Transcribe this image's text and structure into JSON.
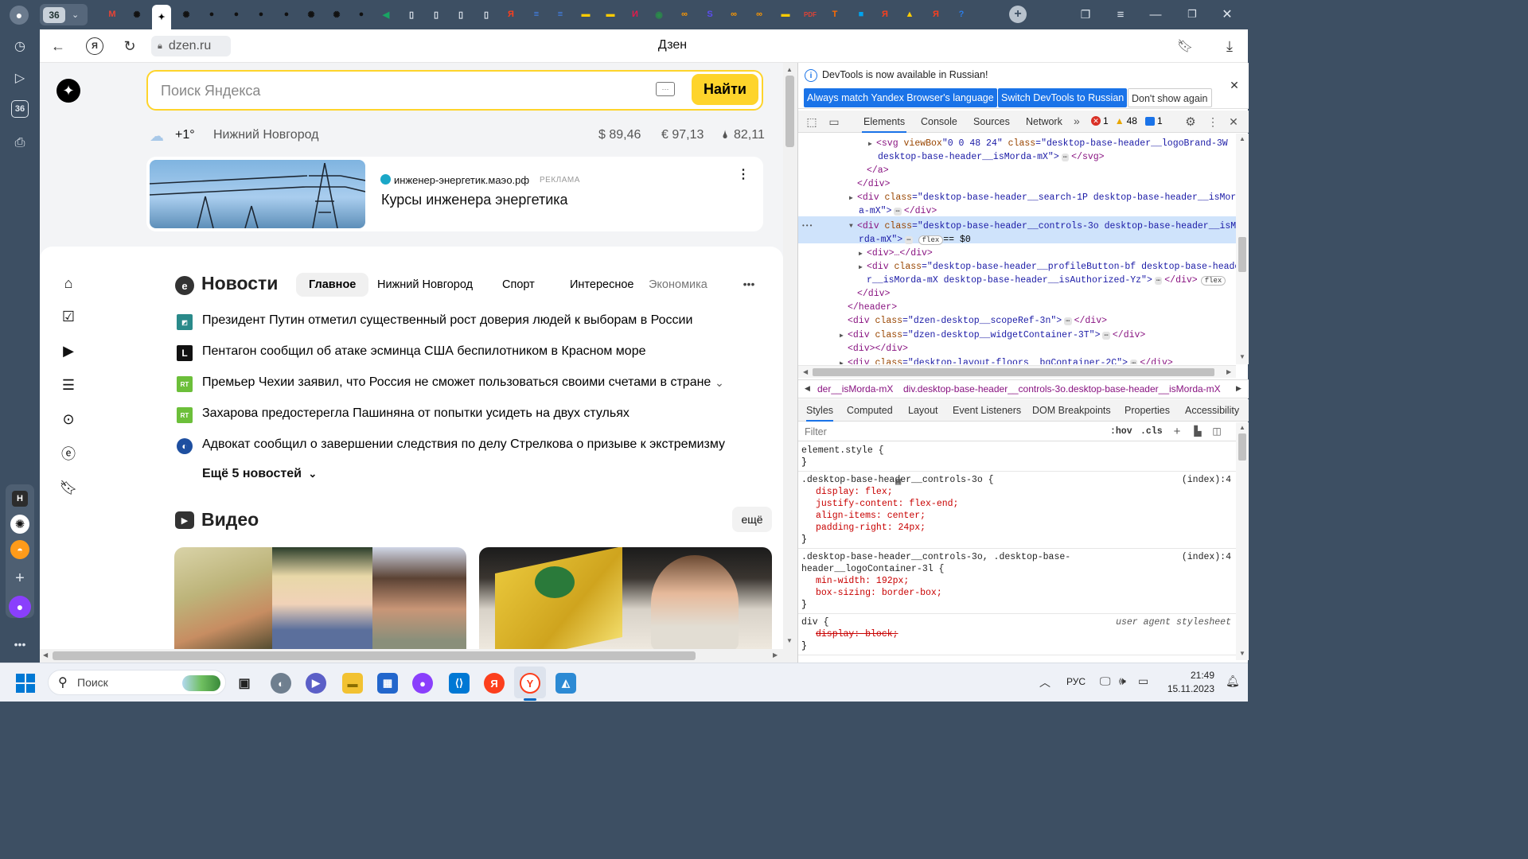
{
  "tabs": {
    "counter": "36",
    "items": [
      {
        "name": "gmail-tab",
        "glyph": "M",
        "color": "#ea4335"
      },
      {
        "name": "chatgpt-tab-1",
        "glyph": "✺",
        "color": "#111"
      },
      {
        "name": "dzen-tab-active",
        "glyph": "✦",
        "color": "#fff"
      },
      {
        "name": "chatgpt-tab-2",
        "glyph": "✺",
        "color": "#111"
      },
      {
        "name": "github-tab-1",
        "glyph": "●",
        "color": "#111"
      },
      {
        "name": "github-tab-2",
        "glyph": "●",
        "color": "#111"
      },
      {
        "name": "github-tab-3",
        "glyph": "●",
        "color": "#111"
      },
      {
        "name": "github-tab-4",
        "glyph": "●",
        "color": "#111"
      },
      {
        "name": "chatgpt-tab-3",
        "glyph": "✺",
        "color": "#111"
      },
      {
        "name": "chatgpt-tab-4",
        "glyph": "✺",
        "color": "#111"
      },
      {
        "name": "github-tab-5",
        "glyph": "●",
        "color": "#111"
      },
      {
        "name": "green-arrow-tab",
        "glyph": "◀",
        "color": "#19a463"
      },
      {
        "name": "doc-tab-1",
        "glyph": "▯",
        "color": "#dfe6ee"
      },
      {
        "name": "doc-tab-2",
        "glyph": "▯",
        "color": "#dfe6ee"
      },
      {
        "name": "doc-tab-3",
        "glyph": "▯",
        "color": "#dfe6ee"
      },
      {
        "name": "doc-tab-4",
        "glyph": "▯",
        "color": "#dfe6ee"
      },
      {
        "name": "yandex-tab-1",
        "glyph": "Я",
        "color": "#fc3f1d"
      },
      {
        "name": "docs-tab-1",
        "glyph": "≡",
        "color": "#4285f4"
      },
      {
        "name": "docs-tab-2",
        "glyph": "≡",
        "color": "#4285f4"
      },
      {
        "name": "yellow-tab-1",
        "glyph": "▬",
        "color": "#ffcc00"
      },
      {
        "name": "yellow-tab-2",
        "glyph": "▬",
        "color": "#ffcc00"
      },
      {
        "name": "red-tab",
        "glyph": "И",
        "color": "#e6194b"
      },
      {
        "name": "owl-tab",
        "glyph": "◉",
        "color": "#2a8a4a"
      },
      {
        "name": "infinity-tab-1",
        "glyph": "∞",
        "color": "#ff9900"
      },
      {
        "name": "purple-s-tab",
        "glyph": "S",
        "color": "#5b4df0"
      },
      {
        "name": "infinity-tab-2",
        "glyph": "∞",
        "color": "#ff9900"
      },
      {
        "name": "infinity-tab-3",
        "glyph": "∞",
        "color": "#ff9900"
      },
      {
        "name": "yellow-tab-3",
        "glyph": "▬",
        "color": "#ffcc00"
      },
      {
        "name": "pdf-tab",
        "glyph": "PDF",
        "color": "#e34234"
      },
      {
        "name": "t-tab",
        "glyph": "T",
        "color": "#ff6b00"
      },
      {
        "name": "windows-tab",
        "glyph": "■",
        "color": "#00a4ef"
      },
      {
        "name": "yandex-tab-2",
        "glyph": "Я",
        "color": "#fc3f1d"
      },
      {
        "name": "image-tab",
        "glyph": "▲",
        "color": "#ffcc00"
      },
      {
        "name": "yandex-tab-3",
        "glyph": "Я",
        "color": "#fc3f1d"
      },
      {
        "name": "help-tab",
        "glyph": "?",
        "color": "#2b7de9"
      }
    ]
  },
  "sidepanel": {
    "counter": "36",
    "h_label": "H"
  },
  "toolbar": {
    "url": "dzen.ru",
    "title": "Дзен"
  },
  "dzen": {
    "search_placeholder": "Поиск Яндекса",
    "search_button": "Найти",
    "temperature": "+1°",
    "city": "Нижний Новгород",
    "usd": "$ 89,46",
    "eur": "€ 97,13",
    "oil": "82,11",
    "ad": {
      "domain": "инженер-энергетик.маэо.рф",
      "label": "РЕКЛАМА",
      "title": "Курсы инженера энергетика"
    },
    "news": {
      "title": "Новости",
      "tabs": [
        "Главное",
        "Нижний Новгород",
        "Спорт",
        "Интересное",
        "Экономика"
      ],
      "items": [
        {
          "source_icon": "◩",
          "color": "#2a8a8a",
          "text": "Президент Путин отметил существенный рост доверия людей к выборам в России"
        },
        {
          "source_icon": "L",
          "color": "#111",
          "text": "Пентагон сообщил об атаке эсминца США беспилотником в Красном море"
        },
        {
          "source_icon": "RT",
          "color": "#6cbf3a",
          "text": "Премьер Чехии заявил, что Россия не сможет пользоваться своими счетами в стране"
        },
        {
          "source_icon": "RT",
          "color": "#6cbf3a",
          "text": "Захарова предостерегла Пашиняна от попытки усидеть на двух стульях"
        },
        {
          "source_icon": "◐",
          "color": "#1e4fa0",
          "text": "Адвокат сообщил о завершении следствия по делу Стрелкова о призыве к экстремизму"
        }
      ],
      "more": "Ещё 5 новостей"
    },
    "video": {
      "title": "Видео",
      "more": "ещё"
    }
  },
  "devtools": {
    "infobar": "DevTools is now available in Russian!",
    "btn_match": "Always match Yandex Browser's language",
    "btn_switch": "Switch DevTools to Russian",
    "btn_dont": "Don't show again",
    "tabs": [
      "Elements",
      "Console",
      "Sources",
      "Network"
    ],
    "errors": "1",
    "warnings": "48",
    "messages": "1",
    "dom": [
      {
        "pre": "<svg ",
        "a": "viewBox",
        "v": "\"0 0 48 24\"",
        "a2": " class",
        "v2": "=\"desktop-base-header__logoBrand-3W"
      },
      {
        "plain": "desktop-base-header__isMorda-mX\">",
        "tail": "</svg>"
      },
      {
        "tagonly": "</a>"
      },
      {
        "tagonly": "</div>"
      },
      {
        "pre": "<div ",
        "a": "class",
        "v": "=\"desktop-base-header__search-1P desktop-base-header__isMord"
      },
      {
        "plain": "a-mX\">",
        "tail": "</div>"
      },
      {
        "pre": "<div ",
        "a": "class",
        "v": "=\"desktop-base-header__controls-3o desktop-base-header__isMo"
      },
      {
        "plain": "rda-mX\">",
        "tail": "== $0"
      },
      {
        "tagonly": "<div>…</div>"
      },
      {
        "pre": "<div ",
        "a": "class",
        "v": "=\"desktop-base-header__profileButton-bf desktop-base-heade"
      },
      {
        "plain": "r__isMorda-mX desktop-base-header__isAuthorized-Yz\">",
        "tail": "</div>"
      },
      {
        "tagonly": "</div>"
      },
      {
        "tagonly": "</header>"
      },
      {
        "pre": "<div ",
        "a": "class",
        "v": "=\"dzen-desktop__scopeRef-3n\">",
        "tail": "</div>"
      },
      {
        "pre": "<div ",
        "a": "class",
        "v": "=\"dzen-desktop__widgetContainer-3T\">",
        "tail": "</div>"
      },
      {
        "tagonly": "<div></div>"
      },
      {
        "pre": "<div ",
        "a": "class",
        "v": "=\"desktop-layout-floors__bgContainer-2C\">",
        "tail": "</div>"
      }
    ],
    "breadcrumb": [
      "der__isMorda-mX",
      "div.desktop-base-header__controls-3o.desktop-base-header__isMorda-mX"
    ],
    "subtabs": [
      "Styles",
      "Computed",
      "Layout",
      "Event Listeners",
      "DOM Breakpoints",
      "Properties",
      "Accessibility"
    ],
    "filter_placeholder": "Filter",
    "hov": ":hov",
    "cls": ".cls",
    "rules": [
      {
        "selector": "element.style {",
        "source": "",
        "props": []
      },
      {
        "selector": ".desktop-base-header__controls-3o {",
        "source": "(index):4",
        "props": [
          "display: flex;",
          "justify-content: flex-end;",
          "align-items: center;",
          "padding-right: 24px;"
        ]
      },
      {
        "selector": ".desktop-base-header__controls-3o, .desktop-base-",
        "selector2": "header__logoContainer-3l {",
        "source": "(index):4",
        "props": [
          "min-width: 192px;",
          "box-sizing: border-box;"
        ]
      },
      {
        "selector": "div {",
        "source": "user agent stylesheet",
        "props": [
          "display: block;"
        ]
      }
    ]
  },
  "taskbar": {
    "search": "Поиск",
    "lang": "РУС",
    "time": "21:49",
    "date": "15.11.2023"
  }
}
